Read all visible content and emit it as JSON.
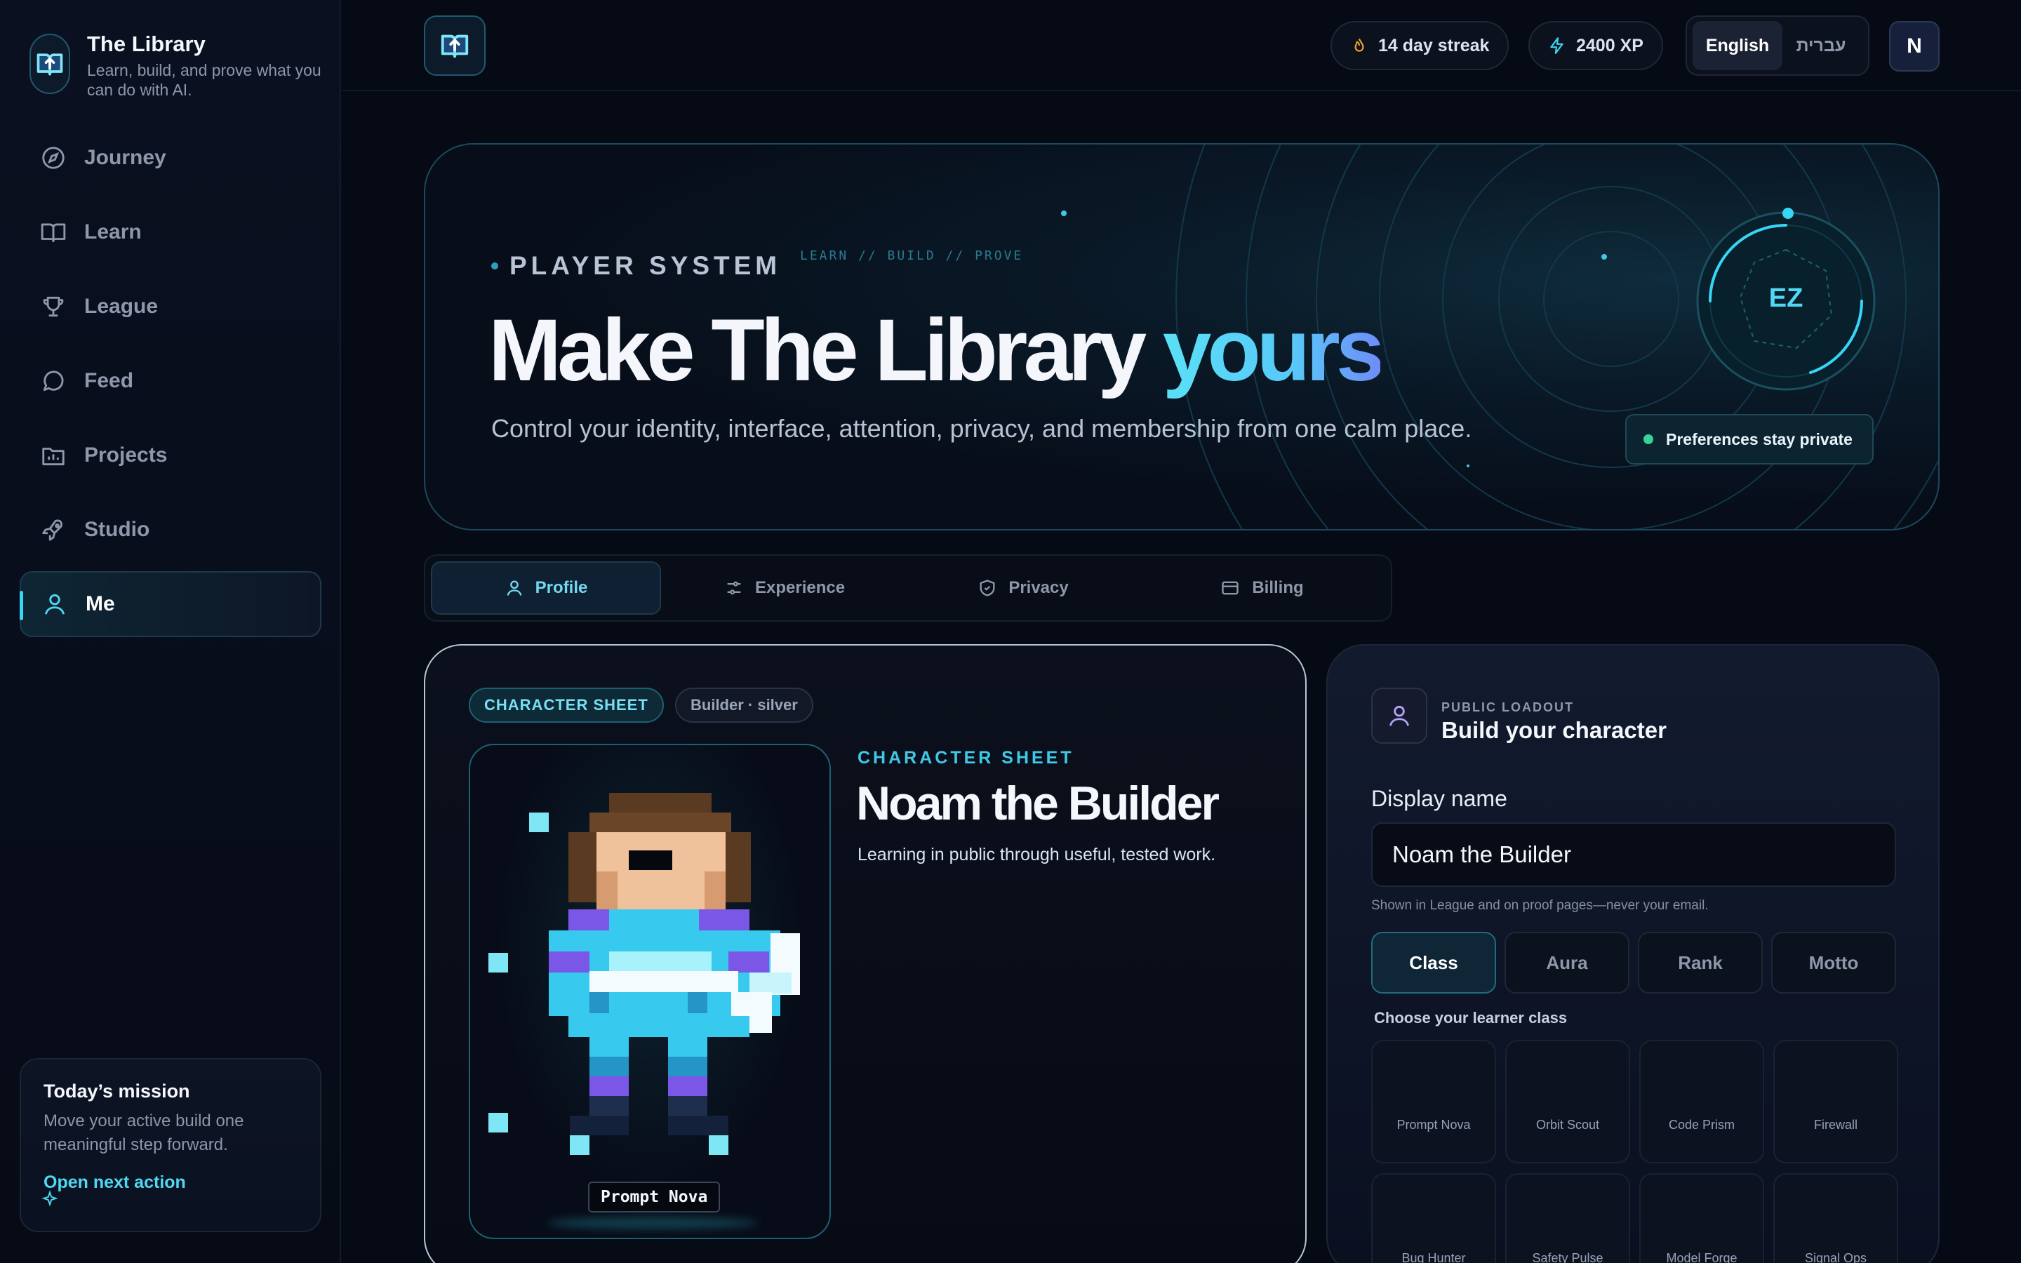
{
  "brand": {
    "title": "The Library",
    "subtitle": "Learn, build, and prove what you can do with AI."
  },
  "nav": [
    {
      "label": "Journey",
      "icon": "compass-icon"
    },
    {
      "label": "Learn",
      "icon": "book-icon"
    },
    {
      "label": "League",
      "icon": "trophy-icon"
    },
    {
      "label": "Feed",
      "icon": "chat-bubble-icon"
    },
    {
      "label": "Projects",
      "icon": "folder-chart-icon"
    },
    {
      "label": "Studio",
      "icon": "rocket-icon"
    },
    {
      "label": "Me",
      "icon": "user-icon",
      "active": true
    }
  ],
  "mission": {
    "title": "Today’s mission",
    "text": "Move your active build one meaningful step forward.",
    "link": "Open next action"
  },
  "topbar": {
    "streak": "14 day streak",
    "xp": "2400 XP",
    "lang_active": "English",
    "lang_other": "עברית",
    "avatar_initial": "N"
  },
  "hero": {
    "eyebrow": "PLAYER SYSTEM",
    "eyebrow_mono": "LEARN // BUILD // PROVE",
    "title_main": "Make The Library ",
    "title_accent": "yours",
    "subtitle": "Control your identity, interface, attention, privacy, and membership from one calm place.",
    "badge_initials": "EZ",
    "privacy_note": "Preferences stay private"
  },
  "tabs": [
    {
      "label": "Profile",
      "icon": "user-icon",
      "active": true
    },
    {
      "label": "Experience",
      "icon": "sliders-icon"
    },
    {
      "label": "Privacy",
      "icon": "shield-check-icon"
    },
    {
      "label": "Billing",
      "icon": "credit-card-icon"
    }
  ],
  "character": {
    "chip_sheet": "CHARACTER SHEET",
    "chip_class": "Builder · silver",
    "eyebrow": "CHARACTER SHEET",
    "name": "Noam the Builder",
    "tagline": "Learning in public through useful, tested work.",
    "portrait_label": "Prompt Nova"
  },
  "loadout": {
    "eyebrow": "PUBLIC LOADOUT",
    "title": "Build your character",
    "field_label": "Display name",
    "field_value": "Noam the Builder",
    "help": "Shown in League and on proof pages—never your email.",
    "segments": [
      {
        "label": "Class",
        "active": true
      },
      {
        "label": "Aura"
      },
      {
        "label": "Rank"
      },
      {
        "label": "Motto"
      }
    ],
    "choose_label": "Choose your learner class",
    "classes": [
      "Prompt Nova",
      "Orbit Scout",
      "Code Prism",
      "Firewall",
      "Bug Hunter",
      "Safety Pulse",
      "Model Forge",
      "Signal Ops"
    ]
  },
  "colors": {
    "accent": "#38d6f5",
    "background": "#060a14",
    "success": "#33d39a"
  }
}
